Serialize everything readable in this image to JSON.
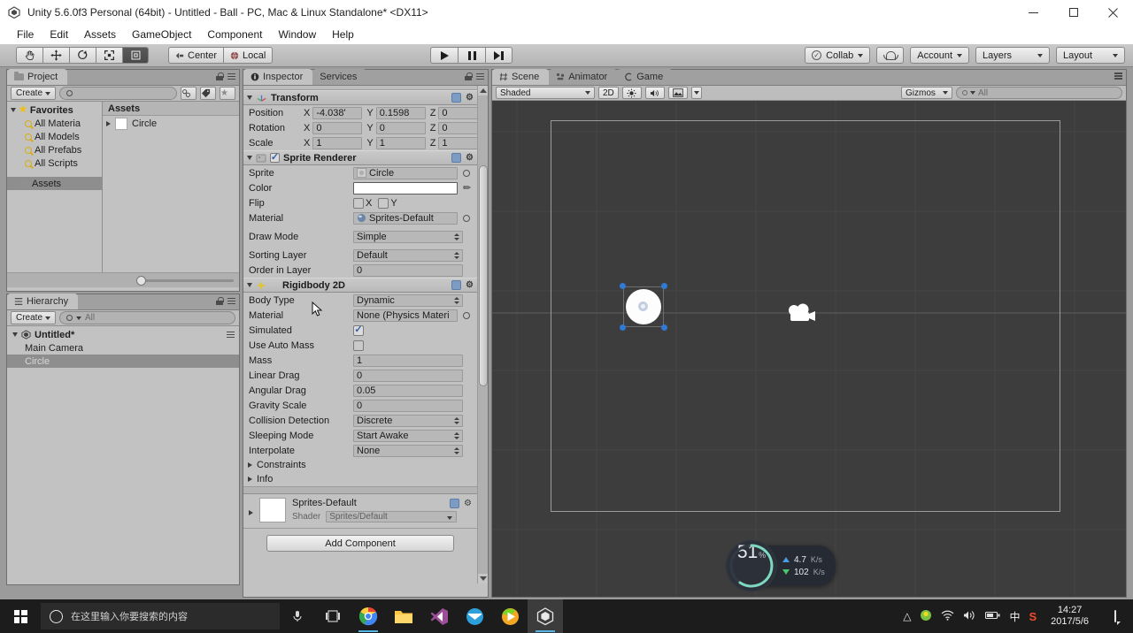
{
  "window": {
    "title": "Unity 5.6.0f3 Personal (64bit) - Untitled - Ball - PC, Mac & Linux Standalone* <DX11>",
    "app_icon": "unity-icon",
    "minimize": "–",
    "maximize": "□",
    "close": "✕"
  },
  "menubar": {
    "items": [
      "File",
      "Edit",
      "Assets",
      "GameObject",
      "Component",
      "Window",
      "Help"
    ]
  },
  "toolbar": {
    "tools": [
      {
        "name": "hand-tool",
        "glyph": "✋"
      },
      {
        "name": "move-tool",
        "glyph": "✥"
      },
      {
        "name": "rotate-tool",
        "glyph": "⟳"
      },
      {
        "name": "scale-tool",
        "glyph": "⤡"
      },
      {
        "name": "rect-tool",
        "glyph": "▣"
      }
    ],
    "pivot_label": "Center",
    "space_label": "Local",
    "play": "play-button",
    "pause": "pause-button",
    "step": "step-button",
    "collab_label": "Collab",
    "cloud_label": "cloud-button",
    "account_label": "Account",
    "layers_label": "Layers",
    "layout_label": "Layout"
  },
  "project": {
    "tab_label": "Project",
    "create_label": "Create",
    "search_placeholder": "",
    "favorites_label": "Favorites",
    "favorites": [
      "All Materia",
      "All Models",
      "All Prefabs",
      "All Scripts"
    ],
    "assets_folder_label": "Assets",
    "content_header": "Assets",
    "items": [
      {
        "name": "Circle"
      }
    ]
  },
  "hierarchy": {
    "tab_label": "Hierarchy",
    "create_label": "Create",
    "search_placeholder": "All",
    "scene_name": "Untitled*",
    "objects": [
      {
        "name": "Main Camera",
        "selected": false
      },
      {
        "name": "Circle",
        "selected": true
      }
    ]
  },
  "inspector": {
    "tab_label": "Inspector",
    "services_tab_label": "Services",
    "transform": {
      "title": "Transform",
      "rows": [
        {
          "label": "Position",
          "x": "-4.038'",
          "y": "0.1598",
          "z": "0"
        },
        {
          "label": "Rotation",
          "x": "0",
          "y": "0",
          "z": "0"
        },
        {
          "label": "Scale",
          "x": "1",
          "y": "1",
          "z": "1"
        }
      ],
      "axes": [
        "X",
        "Y",
        "Z"
      ]
    },
    "sprite_renderer": {
      "title": "Sprite Renderer",
      "enabled": true,
      "sprite_label": "Sprite",
      "sprite_value": "Circle",
      "color_label": "Color",
      "color_value": "#FFFFFF",
      "flip_label": "Flip",
      "flip_x": "X",
      "flip_y": "Y",
      "flip_x_checked": false,
      "flip_y_checked": false,
      "material_label": "Material",
      "material_value": "Sprites-Default",
      "draw_mode_label": "Draw Mode",
      "draw_mode_value": "Simple",
      "sorting_layer_label": "Sorting Layer",
      "sorting_layer_value": "Default",
      "order_label": "Order in Layer",
      "order_value": "0"
    },
    "rigidbody2d": {
      "title": "Rigidbody 2D",
      "body_type_label": "Body Type",
      "body_type_value": "Dynamic",
      "material_label": "Material",
      "material_value": "None (Physics Materi",
      "simulated_label": "Simulated",
      "simulated_checked": true,
      "use_auto_mass_label": "Use Auto Mass",
      "use_auto_mass_checked": false,
      "mass_label": "Mass",
      "mass_value": "1",
      "linear_drag_label": "Linear Drag",
      "linear_drag_value": "0",
      "angular_drag_label": "Angular Drag",
      "angular_drag_value": "0.05",
      "gravity_scale_label": "Gravity Scale",
      "gravity_scale_value": "0",
      "collision_detection_label": "Collision Detection",
      "collision_detection_value": "Discrete",
      "sleeping_mode_label": "Sleeping Mode",
      "sleeping_mode_value": "Start Awake",
      "interpolate_label": "Interpolate",
      "interpolate_value": "None",
      "constraints_label": "Constraints",
      "info_label": "Info"
    },
    "material_preview": {
      "name": "Sprites-Default",
      "shader_label": "Shader",
      "shader_value": "Sprites/Default"
    },
    "add_component_label": "Add Component"
  },
  "scene": {
    "tabs": [
      {
        "label": "Scene",
        "icon": "grid-icon",
        "active": true
      },
      {
        "label": "Animator",
        "icon": "animator-icon",
        "active": false
      },
      {
        "label": "Game",
        "icon": "game-icon",
        "active": false
      }
    ],
    "shading_mode": "Shaded",
    "mode_2d": "2D",
    "lighting_icon": "sun-icon",
    "audio_icon": "speaker-icon",
    "effects_icon": "image-icon",
    "gizmos_label": "Gizmos",
    "search_placeholder": "All",
    "objects": [
      {
        "name": "Circle",
        "type": "sprite",
        "selected": true
      },
      {
        "name": "Main Camera",
        "type": "camera",
        "selected": false
      }
    ]
  },
  "net_overlay": {
    "percent": "51",
    "percent_unit": "%",
    "upload_value": "4.7",
    "upload_unit": "K/s",
    "download_value": "102",
    "download_unit": "K/s"
  },
  "taskbar": {
    "start_label": "start-button",
    "search_placeholder": "在这里输入你要搜索的内容",
    "mic_icon": "microphone-icon",
    "taskview_icon": "task-view-icon",
    "apps": [
      {
        "name": "chrome",
        "running": true
      },
      {
        "name": "file-explorer",
        "running": false
      },
      {
        "name": "visual-studio",
        "running": false
      },
      {
        "name": "thunderbird",
        "running": false
      },
      {
        "name": "media-player",
        "running": false
      },
      {
        "name": "unity",
        "running": true,
        "active": true
      }
    ],
    "tray": [
      "chevron-up-icon",
      "nvidia-icon",
      "wifi-icon",
      "volume-icon",
      "battery-icon",
      "ime-icon",
      "sogou-icon"
    ],
    "time": "14:27",
    "date": "2017/5/6",
    "action_center": "action-center-icon"
  },
  "colors": {
    "accent_blue": "#2f7ad6",
    "scene_bg": "#3d3d3d",
    "panel_bg": "#c2c2c2",
    "taskbar_bg": "#1c1c1c",
    "check_blue": "#2f5fa8"
  }
}
